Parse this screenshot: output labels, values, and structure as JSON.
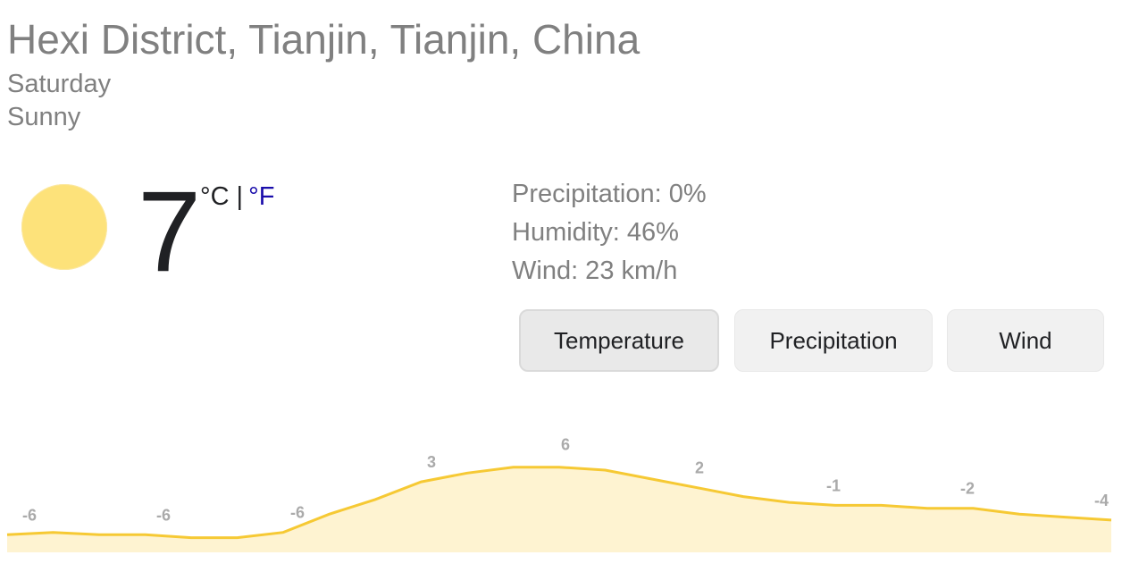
{
  "location": "Hexi District, Tianjin, Tianjin, China",
  "day": "Saturday",
  "condition": "Sunny",
  "current": {
    "temperature": "7",
    "unit_c": "°C",
    "separator": "|",
    "unit_f": "°F",
    "icon": "sun-icon"
  },
  "details": {
    "precipitation": "Precipitation: 0%",
    "humidity": "Humidity: 46%",
    "wind": "Wind: 23 km/h"
  },
  "tabs": {
    "items": [
      "Temperature",
      "Precipitation",
      "Wind"
    ],
    "active": "Temperature"
  },
  "colors": {
    "line": "#f6c934",
    "fill": "#fef3d1",
    "sun": "#fde27a",
    "link": "#1a0dab"
  },
  "chart_data": {
    "type": "area",
    "title": "",
    "xlabel": "",
    "ylabel": "",
    "labels": [
      "-6",
      "-6",
      "-6",
      "3",
      "6",
      "2",
      "-1",
      "-2",
      "-4"
    ],
    "label_values": [
      -6,
      -6,
      -6,
      3,
      6,
      2,
      -1,
      -2,
      -4
    ],
    "series": [
      {
        "values": [
          -6,
          -5.6,
          -6,
          -6,
          -6.5,
          -6.5,
          -5.6,
          -2.5,
          0,
          3,
          4.5,
          5.5,
          5.5,
          5,
          3.5,
          2,
          0.5,
          -0.5,
          -1,
          -1,
          -1.5,
          -1.5,
          -2.5,
          -3,
          -3.5
        ]
      }
    ],
    "ylim": [
      -9,
      12
    ],
    "grid": false,
    "legend": "none"
  }
}
